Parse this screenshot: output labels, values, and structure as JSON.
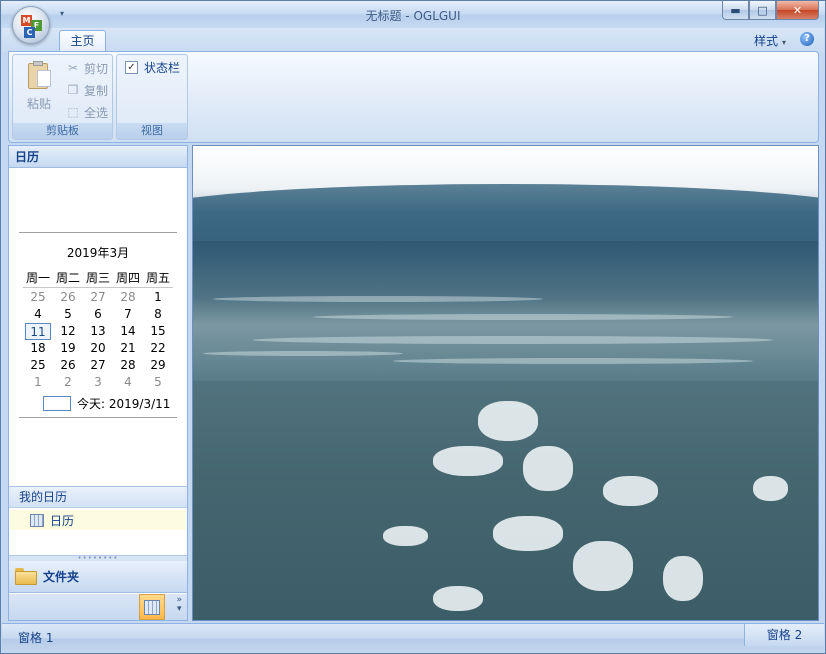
{
  "window": {
    "title": "无标题 - OGLGUI",
    "app_orb_letters": [
      "M",
      "F",
      "C"
    ],
    "controls": [
      "minimize",
      "maximize",
      "close"
    ]
  },
  "ribbon": {
    "tabs": [
      {
        "label": "主页",
        "selected": true
      }
    ],
    "style_menu": "样式",
    "help": "?",
    "groups": {
      "clipboard": {
        "label": "剪贴板",
        "paste": "粘贴",
        "cut": "剪切",
        "copy": "复制",
        "select_all": "全选"
      },
      "view": {
        "label": "视图",
        "status_bar": "状态栏",
        "status_bar_checked": true
      }
    }
  },
  "nav_pane": {
    "header": "日历",
    "calendar": {
      "month_title": "2019年3月",
      "weekdays": [
        "周一",
        "周二",
        "周三",
        "周四",
        "周五"
      ],
      "weeks": [
        [
          "25",
          "26",
          "27",
          "28",
          "1"
        ],
        [
          "4",
          "5",
          "6",
          "7",
          "8"
        ],
        [
          "11",
          "12",
          "13",
          "14",
          "15"
        ],
        [
          "18",
          "19",
          "20",
          "21",
          "22"
        ],
        [
          "25",
          "26",
          "27",
          "28",
          "29"
        ],
        [
          "1",
          "2",
          "3",
          "4",
          "5"
        ]
      ],
      "today_label": "今天: 2019/3/11"
    },
    "my_calendars_header": "我的日历",
    "my_calendars": [
      "日历"
    ],
    "folder_button": "文件夹",
    "more": "»"
  },
  "statusbar": {
    "pane1": "窗格 1",
    "pane2": "窗格 2"
  },
  "colors": {
    "frame": "#c4d9f1",
    "ribbon_text": "#15428b",
    "selected_item_bg": "#fdfbe0",
    "active_button": "#ffb84a",
    "sea": "#3d6375"
  }
}
